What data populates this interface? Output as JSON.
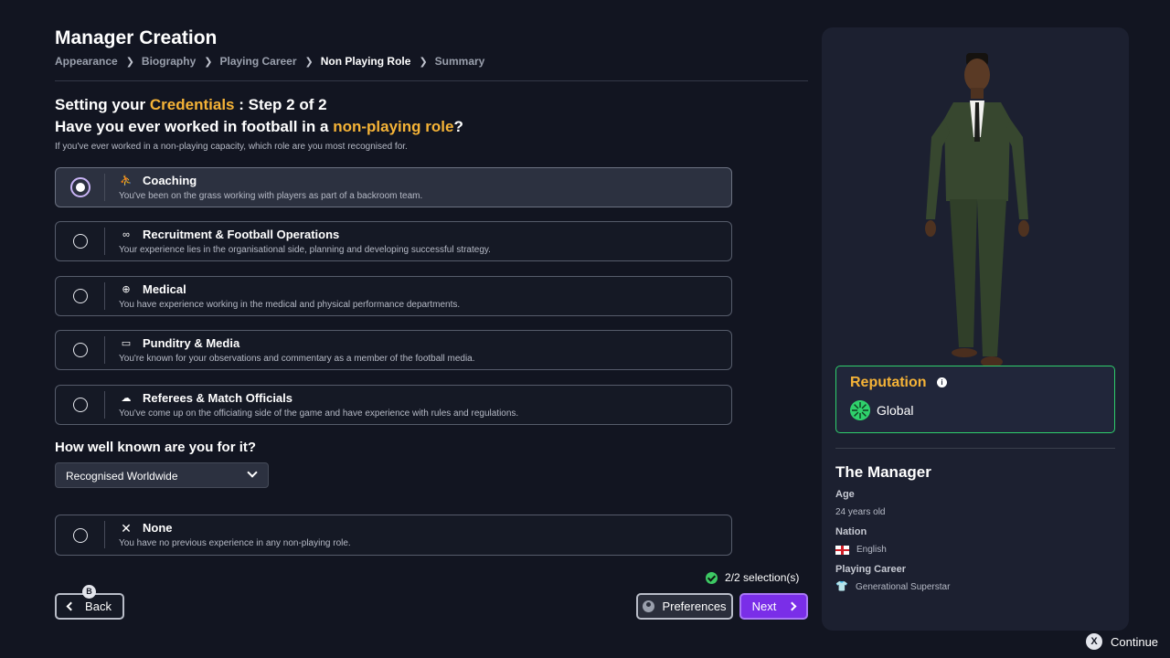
{
  "header": {
    "title": "Manager Creation",
    "breadcrumb": [
      "Appearance",
      "Biography",
      "Playing Career",
      "Non Playing Role",
      "Summary"
    ],
    "active_crumb": "Non Playing Role"
  },
  "step": {
    "prefix": "Setting your ",
    "highlight": "Credentials",
    "suffix": " : Step 2 of 2"
  },
  "question": {
    "prefix": "Have you ever worked in football in a ",
    "highlight": "non-playing role",
    "suffix": "?",
    "instructions": "If you've ever worked in a non-playing capacity, which role are you most recognised for."
  },
  "options": [
    {
      "icon": "whistle-coach-icon",
      "title": "Coaching",
      "desc": "You've been on the grass working with players as part of a backroom team.",
      "selected": true
    },
    {
      "icon": "binoculars-icon",
      "title": "Recruitment & Football Operations",
      "desc": "Your experience lies in the organisational side, planning and developing successful strategy.",
      "selected": false
    },
    {
      "icon": "medical-bag-icon",
      "title": "Medical",
      "desc": "You have experience working in the medical and physical performance departments.",
      "selected": false
    },
    {
      "icon": "monitor-icon",
      "title": "Punditry & Media",
      "desc": "You're known for your observations and commentary as a member of the football media.",
      "selected": false
    },
    {
      "icon": "whistle-icon",
      "title": "Referees & Match Officials",
      "desc": "You've come up on the officiating side of the game and have experience with rules and regulations.",
      "selected": false
    }
  ],
  "known": {
    "label": "How well known are you for it?",
    "selected": "Recognised Worldwide"
  },
  "none_option": {
    "icon": "close-icon",
    "title": "None",
    "desc": "You have no previous experience in any non-playing role.",
    "selected": false
  },
  "footer": {
    "selection_count": "2/2 selection(s)",
    "back_label": "Back",
    "back_badge": "B",
    "preferences_label": "Preferences",
    "next_label": "Next",
    "continue_label": "Continue",
    "continue_badge": "X"
  },
  "panel": {
    "reputation_label": "Reputation",
    "reputation_value": "Global",
    "manager_title": "The Manager",
    "age_label": "Age",
    "age_value": "24 years old",
    "nation_label": "Nation",
    "nation_value": "English",
    "career_label": "Playing Career",
    "career_value": "Generational Superstar"
  },
  "colors": {
    "accent": "#f5b337",
    "next_button": "#7a2ee8",
    "reputation_border": "#2fd06c",
    "background": "#121521"
  }
}
